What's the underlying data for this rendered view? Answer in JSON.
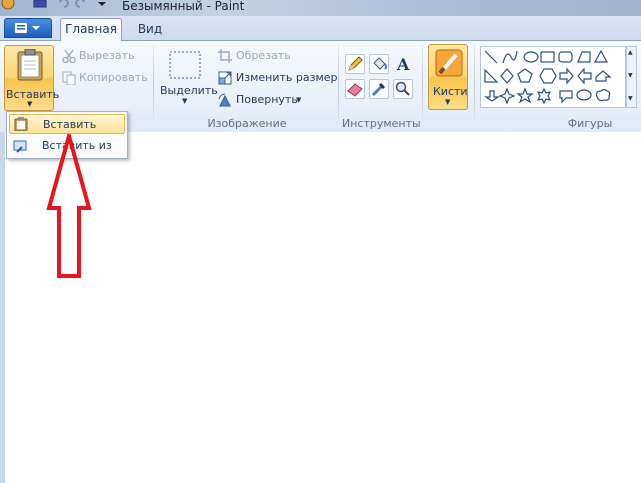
{
  "window": {
    "title": "Безымянный - Paint"
  },
  "tabs": {
    "home": "Главная",
    "view": "Вид"
  },
  "clipboard": {
    "paste_label": "Вставить",
    "cut_label": "Вырезать",
    "copy_label": "Копировать"
  },
  "image": {
    "select_label": "Выделить",
    "crop_label": "Обрезать",
    "resize_label": "Изменить размер",
    "rotate_label": "Повернуть",
    "group_label": "Изображение"
  },
  "tools": {
    "group_label": "Инструменты"
  },
  "brushes": {
    "label": "Кисти"
  },
  "shapes": {
    "group_label": "Фигуры"
  },
  "dropdown": {
    "paste": "Вставить",
    "paste_from": "Вставить из"
  },
  "colors": {
    "accent": "#fbd774",
    "arrow": "#e8151b",
    "ribbon": "#e9f0f9"
  }
}
